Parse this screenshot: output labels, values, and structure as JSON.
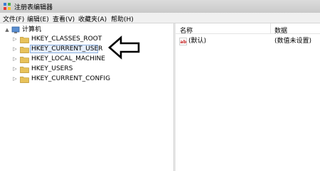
{
  "window": {
    "title": "注册表编辑器",
    "icon": "registry-editor-icon"
  },
  "menu": {
    "items": [
      "文件(F)",
      "编辑(E)",
      "查看(V)",
      "收藏夹(A)",
      "帮助(H)"
    ]
  },
  "tree": {
    "root": "计算机",
    "root_expander": "▲",
    "nodes": [
      {
        "label": "HKEY_CLASSES_ROOT",
        "expander": "▷"
      },
      {
        "label": "HKEY_CURRENT_USER",
        "expander": "▷"
      },
      {
        "label": "HKEY_LOCAL_MACHINE",
        "expander": "▷"
      },
      {
        "label": "HKEY_USERS",
        "expander": "▷"
      },
      {
        "label": "HKEY_CURRENT_CONFIG",
        "expander": "▷"
      }
    ],
    "folder_color": "#e8c25a"
  },
  "values": {
    "headers": {
      "name": "名称",
      "data": "数据"
    },
    "rows": [
      {
        "name": "(默认)",
        "data": "(数值未设置)",
        "icon": "string-value-icon"
      }
    ]
  },
  "annotation": {
    "icon": "arrow-left-icon"
  }
}
